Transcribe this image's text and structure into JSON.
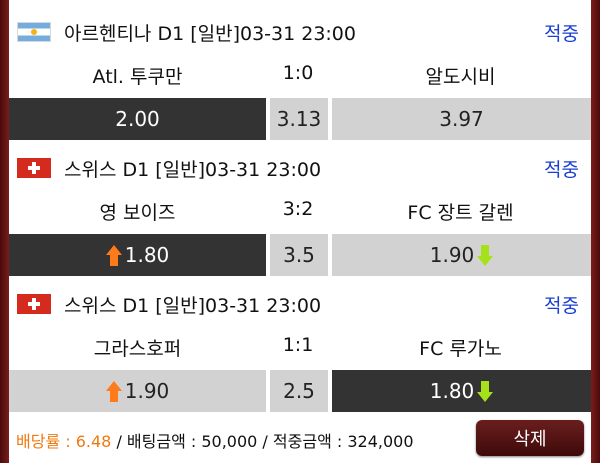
{
  "matches": [
    {
      "flag": "argentina-flag",
      "league": "아르헨티나 D1 [일반]03-31 23:00",
      "status": "적중",
      "home_team": "Atl. 투쿠만",
      "score": "1:0",
      "away_team": "알도시비",
      "odds_home": "2.00",
      "odds_draw": "3.13",
      "odds_away": "3.97",
      "selected": "home"
    },
    {
      "flag": "switzerland-flag",
      "league": "스위스 D1 [일반]03-31 23:00",
      "status": "적중",
      "home_team": "영 보이즈",
      "score": "3:2",
      "away_team": "FC 장트 갈렌",
      "odds_home": "1.80",
      "odds_draw": "3.5",
      "odds_away": "1.90",
      "selected": "home",
      "home_trend": "up",
      "away_trend": "down"
    },
    {
      "flag": "switzerland-flag",
      "league": "스위스 D1 [일반]03-31 23:00",
      "status": "적중",
      "home_team": "그라스호퍼",
      "score": "1:1",
      "away_team": "FC 루가노",
      "odds_home": "1.90",
      "odds_draw": "2.5",
      "odds_away": "1.80",
      "selected": "away",
      "home_trend": "up",
      "away_trend": "down"
    }
  ],
  "summary": {
    "rate_label": "배당률 : ",
    "rate_value": "6.48",
    "bet_text": " / 배팅금액 : 50,000 / 적중금액 : 324,000"
  },
  "delete_label": "삭제",
  "colors": {
    "hit_blue": "#1a3fd1",
    "selected_cell": "#333333",
    "unselected_cell": "#d2d2d2",
    "up_arrow": "#ff7a1a",
    "down_arrow": "#a6e21a",
    "frame": "#5a0f0f"
  }
}
